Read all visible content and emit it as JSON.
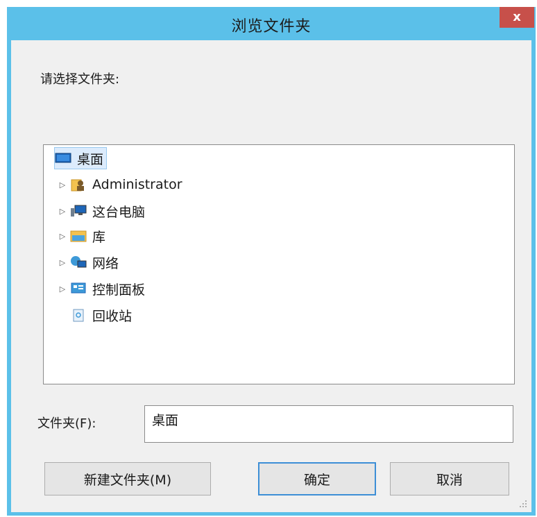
{
  "dialog": {
    "title": "浏览文件夹",
    "close_label": "x",
    "prompt": "请选择文件夹:",
    "tree": {
      "items": [
        {
          "label": "桌面",
          "icon": "desktop-icon",
          "expandable": false,
          "selected": true
        },
        {
          "label": "Administrator",
          "icon": "user-folder-icon",
          "expandable": true
        },
        {
          "label": "这台电脑",
          "icon": "computer-icon",
          "expandable": true
        },
        {
          "label": "库",
          "icon": "library-icon",
          "expandable": true
        },
        {
          "label": "网络",
          "icon": "network-icon",
          "expandable": true
        },
        {
          "label": "控制面板",
          "icon": "control-panel-icon",
          "expandable": true
        },
        {
          "label": "回收站",
          "icon": "recycle-bin-icon",
          "expandable": false
        }
      ],
      "expander_glyph": "▷"
    },
    "folder_field": {
      "label": "文件夹(F):",
      "value": "桌面"
    },
    "buttons": {
      "new_folder": "新建文件夹(M)",
      "ok": "确定",
      "cancel": "取消"
    }
  },
  "colors": {
    "titlebar": "#5bc0e9",
    "close": "#c7504a",
    "client": "#f0f0f0",
    "selection": "#dcebfc"
  }
}
